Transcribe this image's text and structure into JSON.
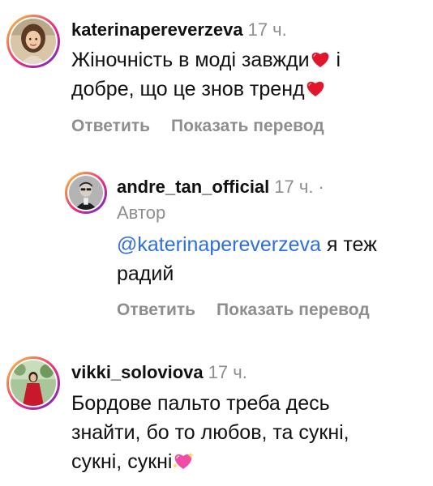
{
  "comments": [
    {
      "username": "katerinapereverzeva",
      "time": "17 ч.",
      "text_line1": "Жіночність в моді завжди",
      "text_line1_after": " і",
      "text_line2": "добре, що це знов тренд",
      "emoji": "red-heart",
      "reply_label": "Ответить",
      "translate_label": "Показать перевод"
    },
    {
      "username": "andre_tan_official",
      "time": "17 ч.",
      "dot": "·",
      "author_tag": "Автор",
      "mention": "@katerinapereverzeva",
      "text_line1_after": " я теж",
      "text_line2": "радий",
      "reply_label": "Ответить",
      "translate_label": "Показать перевод"
    },
    {
      "username": "vikki_soloviova",
      "time": "17 ч.",
      "text_line1": "Бордове пальто треба десь",
      "text_line2": "знайти, бо то любов, та сукні,",
      "text_line3": "сукні, сукні",
      "emoji": "sparkling-heart"
    }
  ],
  "colors": {
    "mention": "#2f6fdb",
    "muted": "#8e8e8e",
    "text": "#111111",
    "heart": "#e0162b",
    "sparkle_heart": "#f04da6"
  }
}
